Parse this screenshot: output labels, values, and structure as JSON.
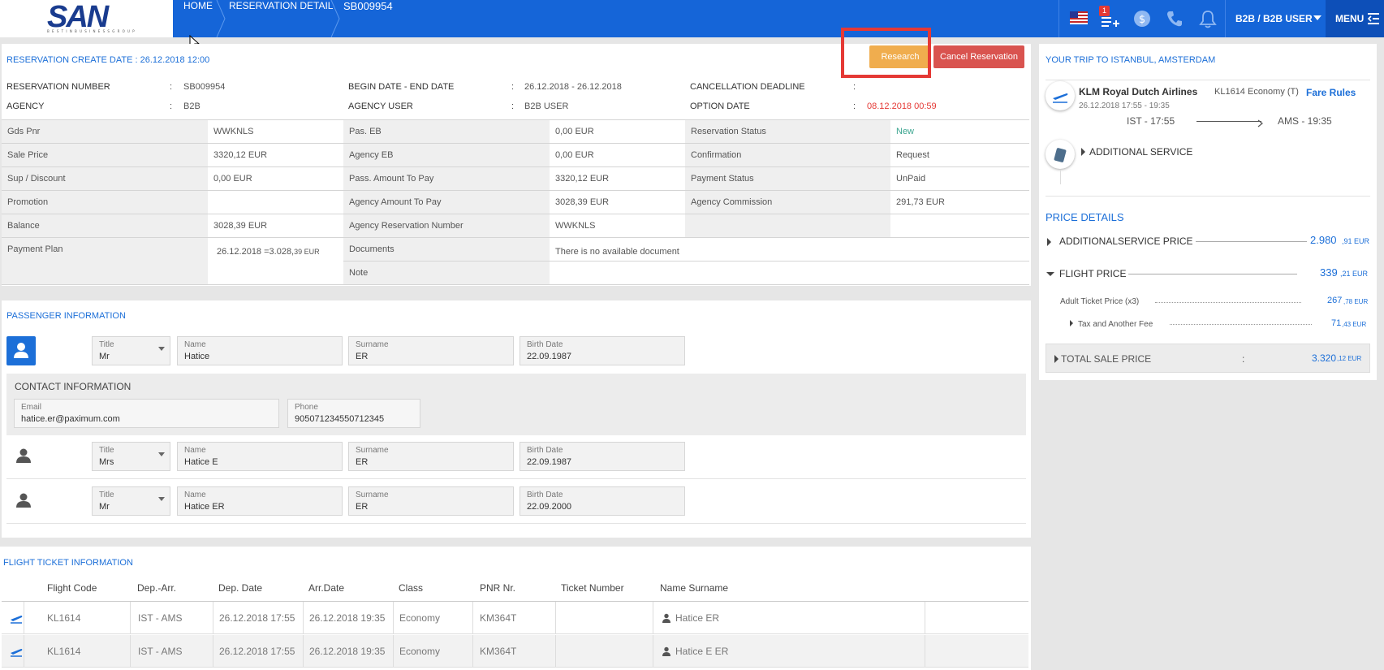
{
  "header": {
    "logo_text": "SAN",
    "logo_tagline": "B E S T  I N  B U S I N E S S  G R O U P",
    "breadcrumbs": [
      "HOME",
      "RESERVATION DETAIL",
      "SB009954"
    ],
    "notification_count": "1",
    "user_label": "B2B / B2B USER",
    "menu_label": "MENU"
  },
  "reservation": {
    "create_date": "RESERVATION CREATE DATE : 26.12.2018 12:00",
    "research_label": "Research",
    "cancel_label": "Cancel Reservation",
    "summary": [
      {
        "label": "RESERVATION NUMBER",
        "value": "SB009954"
      },
      {
        "label": "BEGIN DATE - END DATE",
        "value": "26.12.2018 - 26.12.2018"
      },
      {
        "label": "CANCELLATION DEADLINE",
        "value": ""
      },
      {
        "label": "AGENCY",
        "value": "B2B"
      },
      {
        "label": "AGENCY USER",
        "value": "B2B USER"
      },
      {
        "label": "OPTION DATE",
        "value": "08.12.2018 00:59"
      }
    ],
    "grid": [
      [
        "Gds Pnr",
        "WWKNLS",
        "Pas. EB",
        "0,00 EUR",
        "Reservation Status",
        "New"
      ],
      [
        "Sale Price",
        "3320,12 EUR",
        "Agency EB",
        "0,00 EUR",
        "Confirmation",
        "Request"
      ],
      [
        "Sup / Discount",
        "0,00 EUR",
        "Pass. Amount To Pay",
        "3320,12 EUR",
        "Payment Status",
        "UnPaid"
      ],
      [
        "Promotion",
        "",
        "Agency Amount To Pay",
        "3028,39 EUR",
        "Agency Commission",
        "291,73 EUR"
      ],
      [
        "Balance",
        "3028,39 EUR",
        "Agency Reservation Number",
        "WWKNLS",
        "",
        ""
      ]
    ],
    "payment_plan_label": "Payment Plan",
    "payment_plan_value": "26.12.2018 =3.028,",
    "payment_plan_dec": "39 EUR",
    "documents_label": "Documents",
    "documents_value": "There is no available document",
    "note_label": "Note"
  },
  "passengers": {
    "title": "PASSENGER INFORMATION",
    "field_labels": {
      "title": "Title",
      "name": "Name",
      "surname": "Surname",
      "birth": "Birth Date"
    },
    "list": [
      {
        "title": "Mr",
        "name": "Hatice",
        "surname": "ER",
        "birth": "22.09.1987"
      },
      {
        "title": "Mrs",
        "name": "Hatice E",
        "surname": "ER",
        "birth": "22.09.1987"
      },
      {
        "title": "Mr",
        "name": "Hatice ER",
        "surname": "ER",
        "birth": "22.09.2000"
      }
    ],
    "contact_title": "CONTACT INFORMATION",
    "email_label": "Email",
    "email": "hatice.er@paximum.com",
    "phone_label": "Phone",
    "phone": "905071234550712345"
  },
  "tickets": {
    "title": "FLIGHT TICKET INFORMATION",
    "columns": [
      "Flight Code",
      "Dep.-Arr.",
      "Dep. Date",
      "Arr.Date",
      "Class",
      "PNR Nr.",
      "Ticket Number",
      "Name Surname"
    ],
    "rows": [
      [
        "KL1614",
        "IST - AMS",
        "26.12.2018 17:55",
        "26.12.2018 19:35",
        "Economy",
        "KM364T",
        "",
        "Hatice ER"
      ],
      [
        "KL1614",
        "IST - AMS",
        "26.12.2018 17:55",
        "26.12.2018 19:35",
        "Economy",
        "KM364T",
        "",
        "Hatice E ER"
      ]
    ]
  },
  "trip": {
    "title": "YOUR TRIP TO ISTANBUL, AMSTERDAM",
    "airline": "KLM Royal Dutch Airlines",
    "flight_info": "KL1614 Economy (T)",
    "fare_rules": "Fare Rules",
    "date_range": "26.12.2018 17:55 - 19:35",
    "dep": "IST - 17:55",
    "arr": "AMS - 19:35",
    "additional_service": "ADDITIONAL SERVICE"
  },
  "price": {
    "title": "PRICE DETAILS",
    "additional_label": "ADDITIONALSERVICE PRICE",
    "additional_int": "2.980",
    "additional_dec": ",91 EUR",
    "flight_label": "FLIGHT PRICE",
    "flight_int": "339",
    "flight_dec": ",21 EUR",
    "adult_label": "Adult Ticket Price (x3)",
    "adult_int": "267",
    "adult_dec": ",78 EUR",
    "tax_label": "Tax and Another Fee",
    "tax_int": "71",
    "tax_dec": ",43 EUR",
    "total_label": "TOTAL SALE PRICE",
    "total_sep": ":",
    "total_int": "3.320",
    "total_dec": ",12 EUR"
  },
  "colors": {
    "header": "#1565d8",
    "research": "#f0ad4e",
    "cancel": "#d9534f",
    "highlight": "#e53935",
    "accent": "#1c6fd8"
  }
}
